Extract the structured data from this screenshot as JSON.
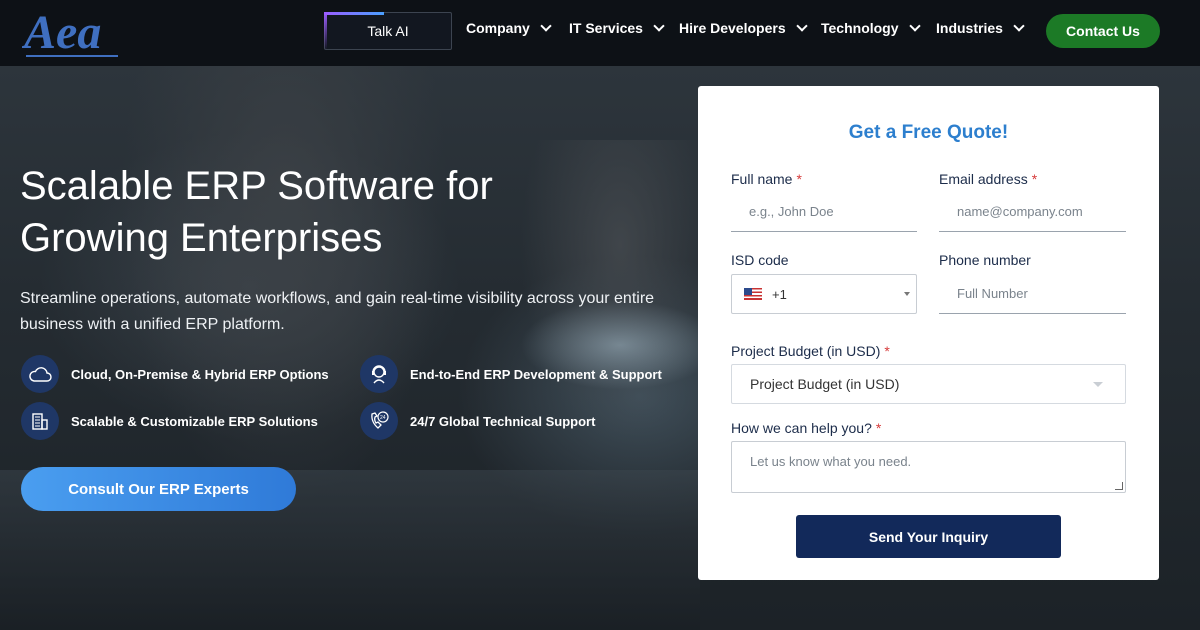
{
  "header": {
    "logo_text": "Aea",
    "talk_ai": "Talk AI",
    "nav": [
      "Company",
      "IT Services",
      "Hire Developers",
      "Technology",
      "Industries"
    ],
    "contact": "Contact Us"
  },
  "hero": {
    "title_line1": "Scalable ERP Software for",
    "title_line2": "Growing Enterprises",
    "subtitle": "Streamline operations, automate workflows, and gain real-time visibility across your entire business with a unified ERP platform.",
    "features": [
      {
        "icon": "cloud-icon",
        "label": "Cloud, On-Premise & Hybrid ERP Options"
      },
      {
        "icon": "developer-support-icon",
        "label": "End-to-End ERP Development & Support"
      },
      {
        "icon": "scalable-building-icon",
        "label": "Scalable & Customizable ERP Solutions"
      },
      {
        "icon": "24-7-support-icon",
        "label": "24/7 Global Technical Support"
      }
    ],
    "cta": "Consult Our ERP Experts"
  },
  "form": {
    "title": "Get a Free Quote!",
    "full_name_label": "Full name",
    "full_name_placeholder": "e.g., John Doe",
    "email_label": "Email address",
    "email_placeholder": "name@company.com",
    "isd_label": "ISD code",
    "isd_value": "+1",
    "phone_label": "Phone number",
    "phone_placeholder": "Full Number",
    "budget_label": "Project Budget (in USD)",
    "budget_value": "Project Budget (in USD)",
    "help_label": "How we can help you?",
    "help_placeholder": "Let us know what you need.",
    "required_mark": "*",
    "submit": "Send Your Inquiry"
  },
  "colors": {
    "accent_green": "#1c7a26",
    "form_title_blue": "#2d7fce",
    "submit_navy": "#12295a",
    "cta_blue": "#3a8ae4"
  }
}
